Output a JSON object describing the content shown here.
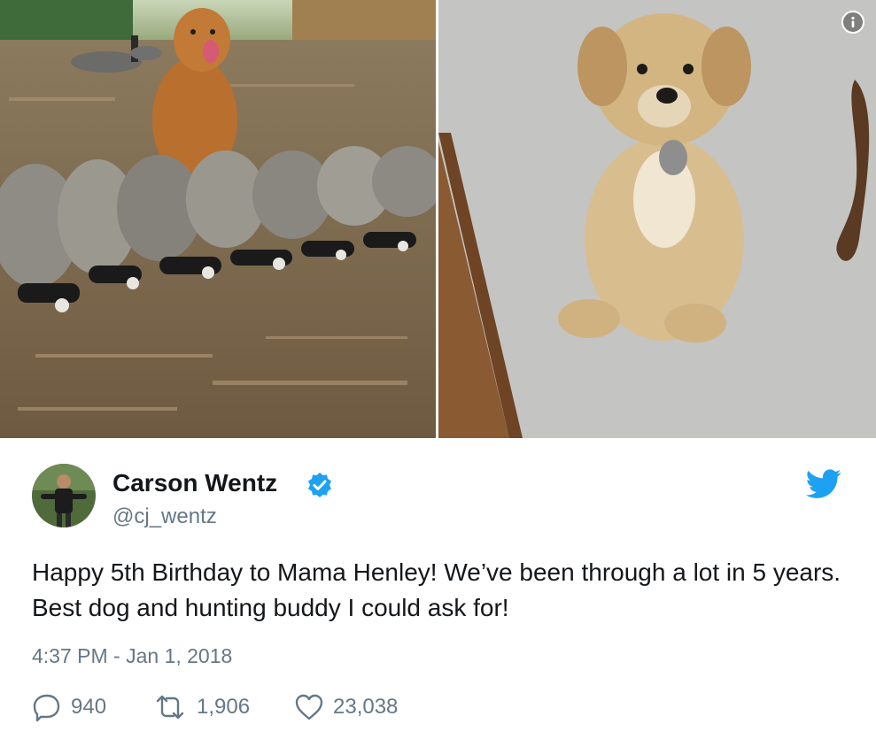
{
  "media": {
    "left_photo": "golden retriever sitting behind row of geese in field",
    "right_photo": "golden retriever puppy sitting on carpet",
    "info_icon": "info-icon"
  },
  "tweet": {
    "author_name": "Carson Wentz",
    "author_handle": "@cj_wentz",
    "verified_icon": "verified-badge-icon",
    "brand_icon": "twitter-bird-icon",
    "text": "Happy 5th Birthday to Mama Henley! We’ve been through a lot in 5 years. Best dog and hunting buddy I could ask for!",
    "timestamp": "4:37 PM - Jan 1, 2018"
  },
  "actions": {
    "reply_count": "940",
    "retweet_count": "1,906",
    "like_count": "23,038"
  },
  "colors": {
    "brand_blue": "#1da1f2",
    "secondary_text": "#657786",
    "primary_text": "#14171a"
  }
}
